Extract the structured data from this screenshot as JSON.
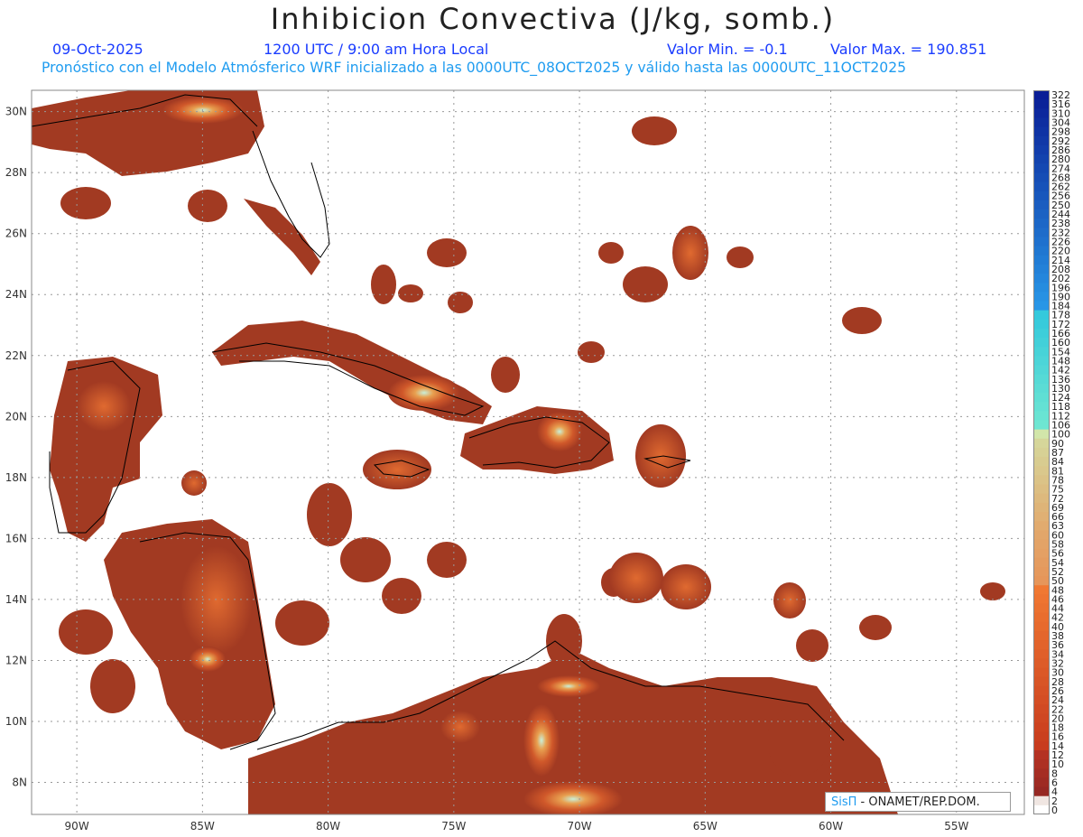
{
  "header": {
    "title": "Inhibicion Convectiva (J/kg, somb.)",
    "date": "09-Oct-2025",
    "time": "1200 UTC / 9:00 am Hora Local",
    "min_label": "Valor Min. = -0.1",
    "max_label": "Valor Max. = 190.851",
    "forecast_line": "Pronóstico con el Modelo Atmósferico WRF inicializado a las 0000UTC_08OCT2025 y válido hasta las  0000UTC_11OCT2025"
  },
  "map": {
    "lon_labels": [
      "90W",
      "85W",
      "80W",
      "75W",
      "70W",
      "65W",
      "60W",
      "55W"
    ],
    "lat_labels": [
      "30N",
      "28N",
      "26N",
      "24N",
      "22N",
      "20N",
      "18N",
      "16N",
      "14N",
      "12N",
      "10N",
      "8N"
    ],
    "lon_values": [
      -90,
      -85,
      -80,
      -75,
      -70,
      -65,
      -60,
      -55
    ],
    "lat_values": [
      30,
      28,
      26,
      24,
      22,
      20,
      18,
      16,
      14,
      12,
      10,
      8
    ],
    "lon_range": [
      -91.8,
      -52.3
    ],
    "lat_range": [
      6.95,
      30.7
    ],
    "land_color": "#a23a22",
    "high_color": "#e8732c",
    "peak_color": "#bfe9b0"
  },
  "colorbar": {
    "levels": [
      "322",
      "316",
      "310",
      "304",
      "298",
      "292",
      "286",
      "280",
      "274",
      "268",
      "262",
      "256",
      "250",
      "244",
      "238",
      "232",
      "226",
      "220",
      "214",
      "208",
      "202",
      "196",
      "190",
      "184",
      "178",
      "172",
      "166",
      "160",
      "154",
      "148",
      "142",
      "136",
      "130",
      "124",
      "118",
      "112",
      "106",
      "100",
      "90",
      "87",
      "84",
      "81",
      "78",
      "75",
      "72",
      "69",
      "66",
      "63",
      "60",
      "58",
      "56",
      "54",
      "52",
      "50",
      "48",
      "46",
      "44",
      "42",
      "40",
      "38",
      "36",
      "34",
      "32",
      "30",
      "28",
      "26",
      "24",
      "22",
      "20",
      "18",
      "16",
      "14",
      "12",
      "10",
      "8",
      "6",
      "4",
      "2",
      "0"
    ]
  },
  "credit": {
    "brand": "SisΠ",
    "org": " - ONAMET/REP.DOM."
  }
}
